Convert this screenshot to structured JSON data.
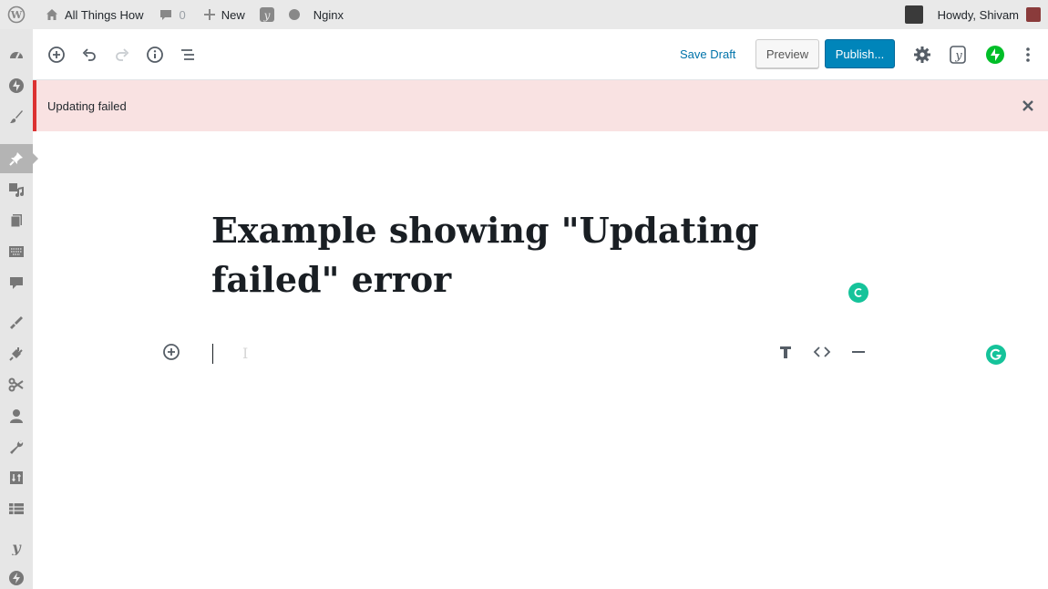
{
  "adminbar": {
    "site_name": "All Things How",
    "comments_count": "0",
    "new_label": "New",
    "nginx_label": "Nginx",
    "howdy": "Howdy, Shivam"
  },
  "toolbar": {
    "save_draft": "Save Draft",
    "preview": "Preview",
    "publish": "Publish..."
  },
  "notice": {
    "text": "Updating failed"
  },
  "post": {
    "title": "Example showing \"Updating failed\" error"
  },
  "colors": {
    "accent": "#0085ba",
    "error": "#dc3232",
    "notice_bg": "#f9e2e2",
    "grammarly": "#15c39a",
    "jetpack": "#00be28"
  }
}
